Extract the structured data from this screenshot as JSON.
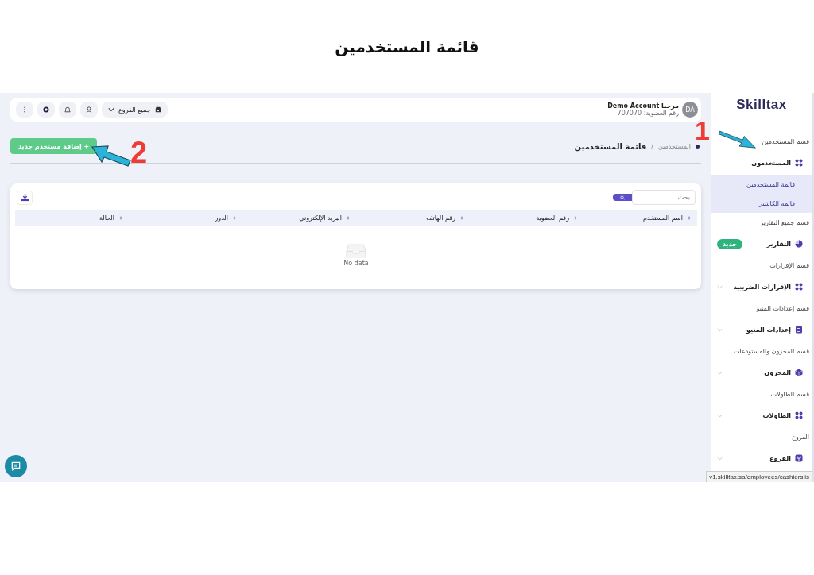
{
  "page_title": "قائمة المستخدمين",
  "annotations": [
    {
      "label": "1"
    },
    {
      "label": "2"
    }
  ],
  "topbar": {
    "avatar": "DA",
    "greeting": "مرحبا Demo Account",
    "membership": "رقم العضوية: 707070",
    "branch": "جميع الفروع"
  },
  "breadcrumb": {
    "parent": "المستخدمين",
    "separator": "/",
    "current": "قائمة المستخدمين"
  },
  "add_button": "+ إضافة مستخدم جديد",
  "table": {
    "search": {
      "placeholder": "بحث"
    },
    "columns": [
      "اسم المستخدم",
      "رقم العضوية",
      "رقم الهاتف",
      "البريد الإلكتروني",
      "الدور",
      "الحالة"
    ],
    "empty_text": "No data"
  },
  "sidebar": {
    "logo": "Skilltax",
    "items": [
      {
        "kind": "section",
        "label": "قسم المستخدمين"
      },
      {
        "kind": "grid",
        "label": "المستخدمون",
        "expanded": true,
        "children": [
          {
            "label": "قائمة المستخدمين"
          },
          {
            "label": "قائمة الكاشير"
          }
        ]
      },
      {
        "kind": "section",
        "label": "قسم جميع التقارير"
      },
      {
        "kind": "pie",
        "label": "التقارير",
        "badge": "جديد"
      },
      {
        "kind": "section",
        "label": "قسم الإقرارات"
      },
      {
        "kind": "grid",
        "label": "الإقرارات الضريبية",
        "expanded": false
      },
      {
        "kind": "section",
        "label": "قسم إعدادات المنيو"
      },
      {
        "kind": "doc",
        "label": "إعدادات المنيو",
        "expanded": false
      },
      {
        "kind": "section",
        "label": "قسم المخزون والمستودعات"
      },
      {
        "kind": "box",
        "label": "المخزون",
        "expanded": false
      },
      {
        "kind": "section",
        "label": "قسم الطاولات"
      },
      {
        "kind": "grid",
        "label": "الطاولات",
        "expanded": false
      },
      {
        "kind": "section",
        "label": "الفروع"
      },
      {
        "kind": "branch",
        "label": "الفروع",
        "expanded": false
      }
    ]
  },
  "status_url": "v1.skilltax.sa/employees/cashierslis"
}
